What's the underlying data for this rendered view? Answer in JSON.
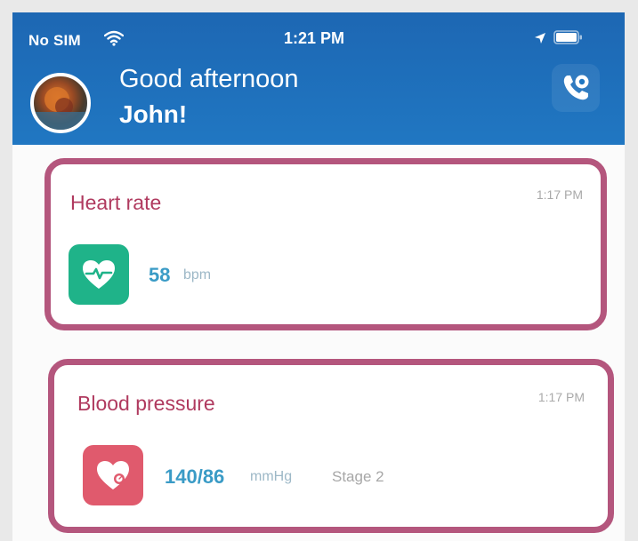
{
  "status_bar": {
    "carrier": "No SIM",
    "time": "1:21 PM"
  },
  "header": {
    "greeting": "Good afternoon",
    "user_name": "John!"
  },
  "cards": [
    {
      "title": "Heart rate",
      "time": "1:17 PM",
      "value": "58",
      "unit": "bpm",
      "icon": "heart-pulse-icon",
      "color": "#1fb389"
    },
    {
      "title": "Blood pressure",
      "time": "1:17 PM",
      "value": "140/86",
      "unit": "mmHg",
      "stage": "Stage 2",
      "icon": "blood-pressure-icon",
      "color": "#e05a6d"
    }
  ],
  "colors": {
    "header": "#2077c2",
    "card_border": "#b4567d",
    "title": "#b03a5f",
    "value": "#3a9bc6"
  }
}
